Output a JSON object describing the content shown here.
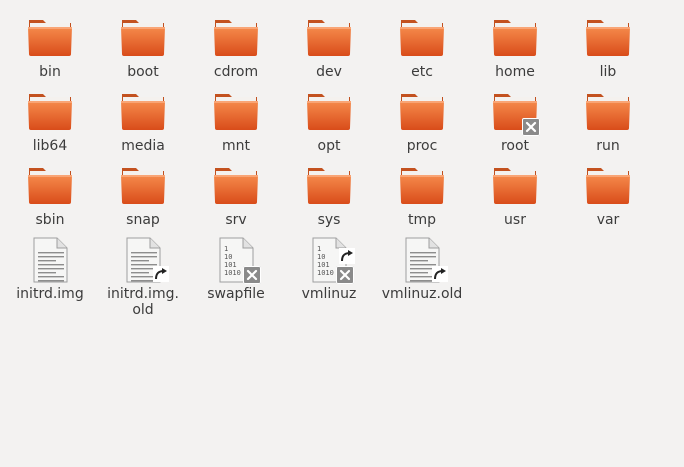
{
  "files": [
    {
      "name": "bin",
      "type": "folder"
    },
    {
      "name": "boot",
      "type": "folder"
    },
    {
      "name": "cdrom",
      "type": "folder"
    },
    {
      "name": "dev",
      "type": "folder"
    },
    {
      "name": "etc",
      "type": "folder"
    },
    {
      "name": "home",
      "type": "folder"
    },
    {
      "name": "lib",
      "type": "folder"
    },
    {
      "name": "lib64",
      "type": "folder"
    },
    {
      "name": "media",
      "type": "folder"
    },
    {
      "name": "mnt",
      "type": "folder"
    },
    {
      "name": "opt",
      "type": "folder"
    },
    {
      "name": "proc",
      "type": "folder"
    },
    {
      "name": "root",
      "type": "folder",
      "emblem": "locked"
    },
    {
      "name": "run",
      "type": "folder"
    },
    {
      "name": "sbin",
      "type": "folder"
    },
    {
      "name": "snap",
      "type": "folder"
    },
    {
      "name": "srv",
      "type": "folder"
    },
    {
      "name": "sys",
      "type": "folder"
    },
    {
      "name": "tmp",
      "type": "folder"
    },
    {
      "name": "usr",
      "type": "folder"
    },
    {
      "name": "var",
      "type": "folder"
    },
    {
      "name": "initrd.img",
      "type": "text-file"
    },
    {
      "name": "initrd.img.old",
      "display": "initrd.img.\nold",
      "type": "text-file",
      "emblem": "symlink"
    },
    {
      "name": "swapfile",
      "type": "binary-file",
      "emblem": "locked"
    },
    {
      "name": "vmlinuz",
      "type": "binary-file",
      "emblem": "symlink-locked"
    },
    {
      "name": "vmlinuz.old",
      "type": "text-file",
      "emblem": "symlink"
    }
  ],
  "binary_glyph_lines": [
    "1",
    "10",
    "101",
    "1010"
  ],
  "colors": {
    "background": "#f3f2f1",
    "folder_light": "#f58a4b",
    "folder_dark": "#d94c1a",
    "label": "#3c3c3c"
  }
}
